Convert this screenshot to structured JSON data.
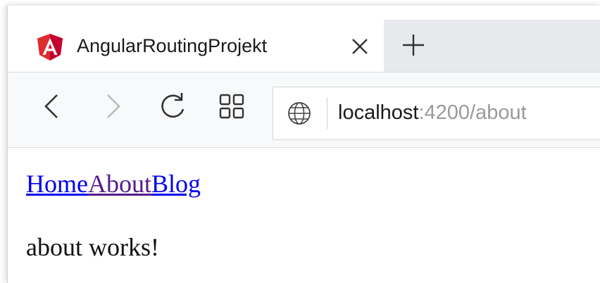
{
  "tab": {
    "title": "AngularRoutingProjekt",
    "favicon": "angular-logo-icon",
    "favicon_color": "#dd2c2f",
    "close_icon": "close-icon",
    "new_tab_icon": "plus-icon"
  },
  "toolbar": {
    "back_icon": "chevron-left-icon",
    "forward_icon": "chevron-right-icon",
    "refresh_icon": "refresh-icon",
    "tabs_icon": "grid-icon",
    "site_icon": "globe-icon",
    "url_host": "localhost",
    "url_rest": ":4200/about"
  },
  "page": {
    "nav_links": [
      {
        "label": "Home",
        "visited": false
      },
      {
        "label": "About",
        "visited": true
      },
      {
        "label": "Blog",
        "visited": false
      }
    ],
    "body_text": "about works!"
  },
  "colors": {
    "link_unvisited": "#0000ee",
    "link_visited": "#551a8b",
    "tab_strip_inactive": "#e7e9ec",
    "toolbar_bg": "#f8f9fa"
  }
}
